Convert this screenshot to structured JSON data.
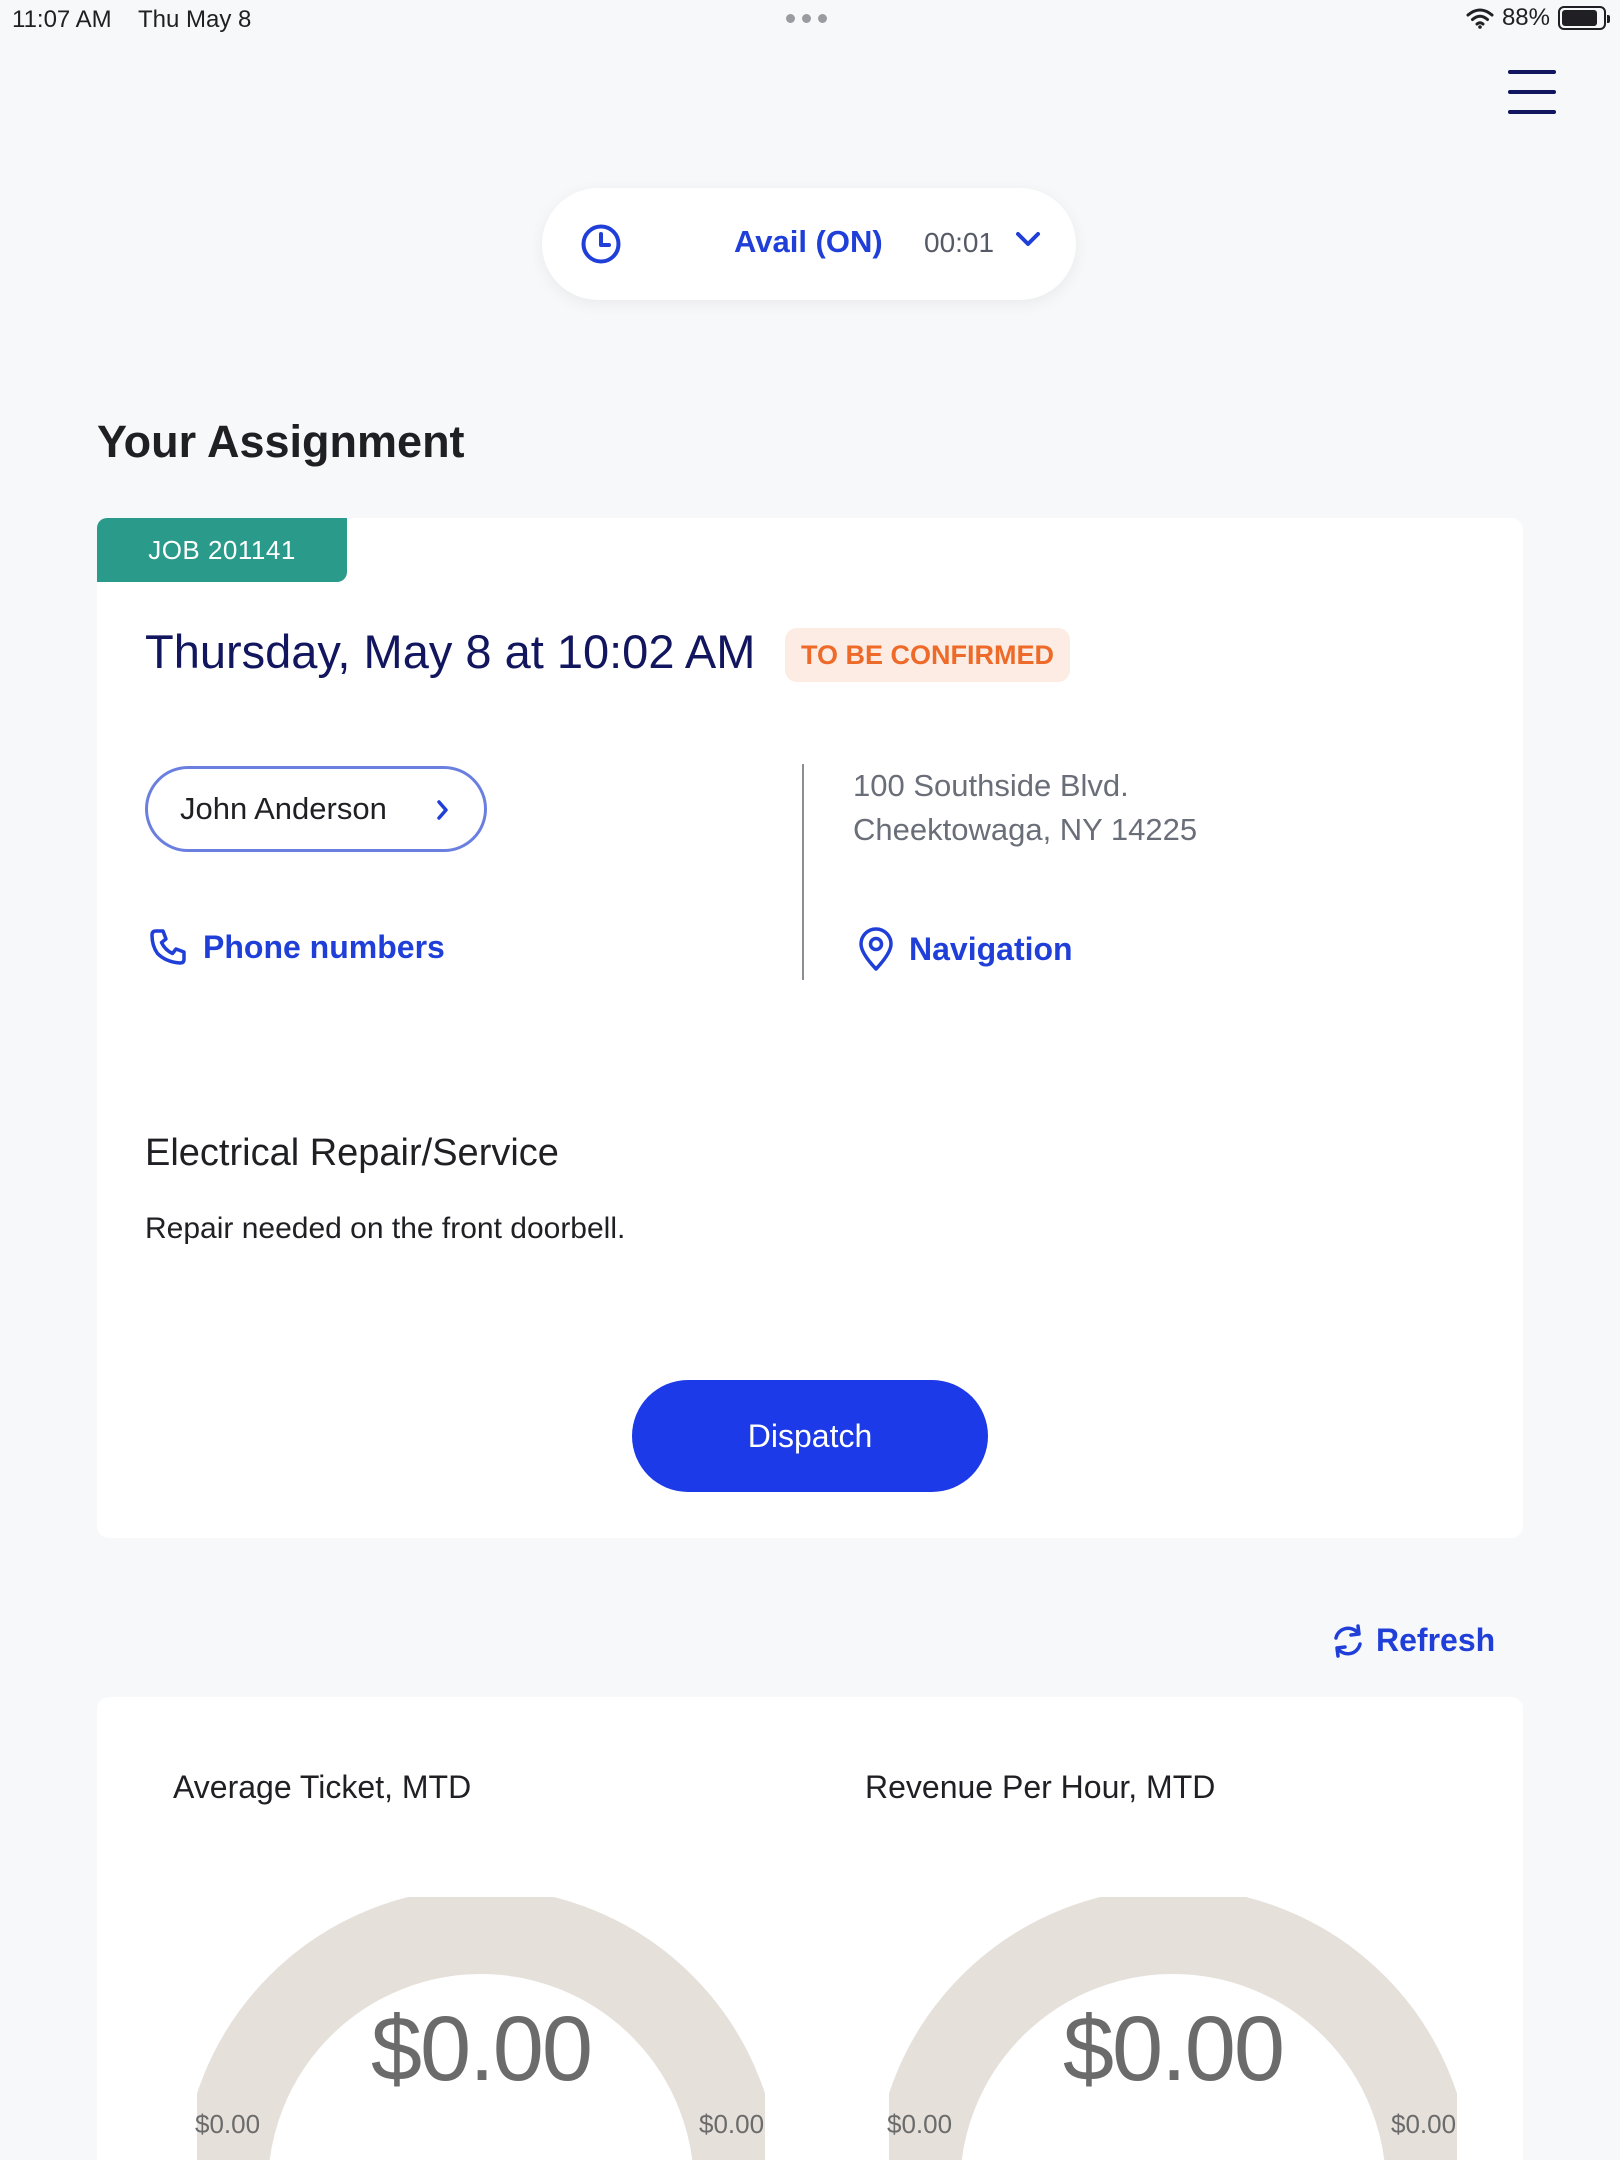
{
  "status_bar": {
    "time": "11:07 AM",
    "date": "Thu May 8",
    "battery": "88%",
    "battery_level": 0.88
  },
  "header": {
    "menu_icon": "hamburger-menu-icon"
  },
  "availability": {
    "status": "Avail (ON)",
    "timer": "00:01",
    "icon": "clock-icon"
  },
  "assignment": {
    "section_title": "Your Assignment",
    "job_label": "JOB 201141",
    "datetime": "Thursday, May 8 at 10:02 AM",
    "status_badge": "TO BE CONFIRMED",
    "customer_name": "John Anderson",
    "address_line1": "100 Southside Blvd.",
    "address_line2": "Cheektowaga, NY 14225",
    "phone_link": "Phone numbers",
    "navigation_link": "Navigation",
    "service_title": "Electrical Repair/Service",
    "service_description": "Repair needed on the front doorbell.",
    "dispatch_label": "Dispatch"
  },
  "refresh_label": "Refresh",
  "metrics": [
    {
      "title": "Average Ticket, MTD",
      "value": "$0.00",
      "min": "$0.00",
      "max": "$0.00"
    },
    {
      "title": "Revenue Per Hour, MTD",
      "value": "$0.00",
      "min": "$0.00",
      "max": "$0.00"
    }
  ],
  "colors": {
    "primary_blue": "#1c3ae8",
    "navy": "#12165e",
    "teal": "#2a9a8a",
    "warning_orange": "#ee6a28",
    "gauge_track": "#e5e0da"
  }
}
